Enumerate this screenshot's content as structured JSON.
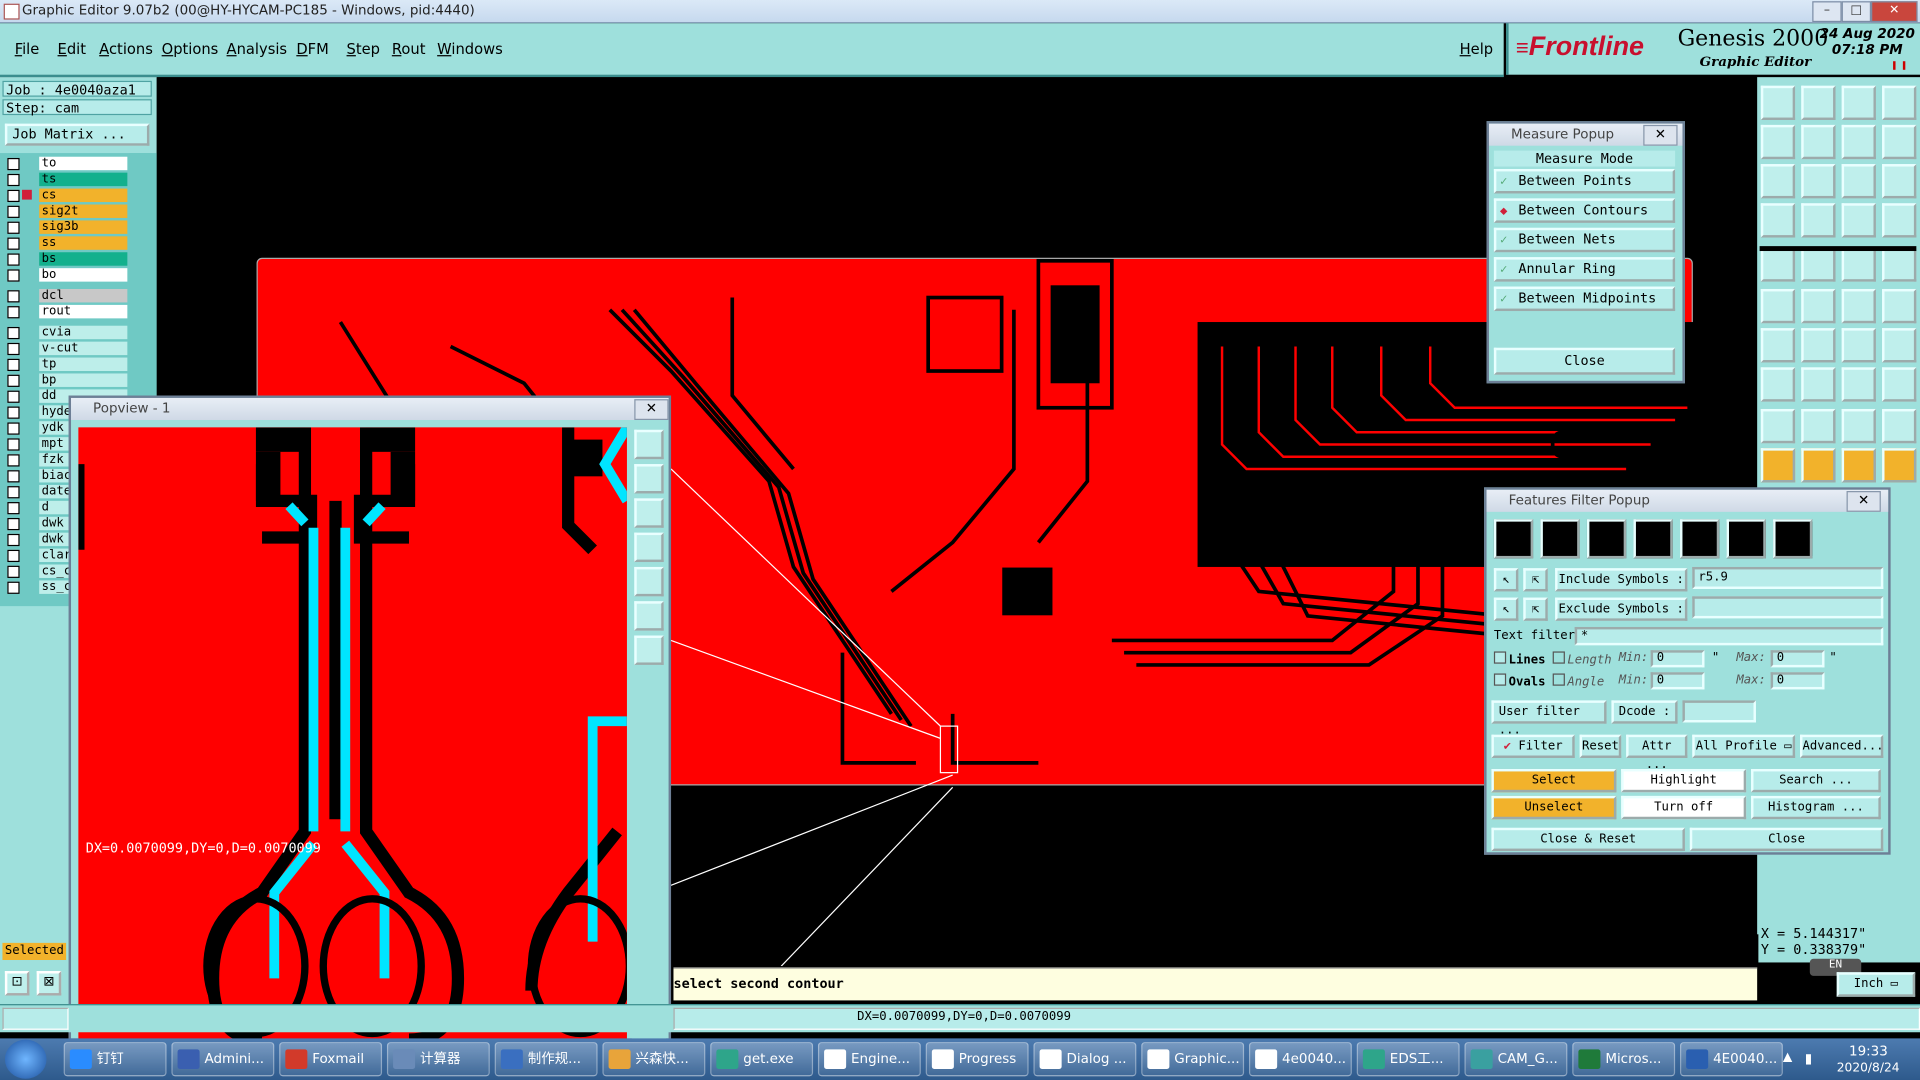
{
  "window": {
    "title": "Graphic Editor 9.07b2 (00@HY-HYCAM-PC185 - Windows, pid:4440)"
  },
  "menu": {
    "items": [
      "File",
      "Edit",
      "Actions",
      "Options",
      "Analysis",
      "DFM",
      "Step",
      "Rout",
      "Windows"
    ],
    "help": "Help"
  },
  "brand": {
    "logo": "Frontline",
    "product": "Genesis 2000",
    "subtitle": "Graphic Editor",
    "date": "24 Aug 2020",
    "time": "07:18 PM"
  },
  "job": {
    "job_line": "Job : 4e0040aza1",
    "step_line": "Step: cam",
    "matrix_button": "Job Matrix ..."
  },
  "layers": [
    {
      "name": "to",
      "color": "#ffffff"
    },
    {
      "name": "ts",
      "color": "#13b08d"
    },
    {
      "name": "cs",
      "color": "#f2b22b"
    },
    {
      "name": "sig2t",
      "color": "#f2b22b"
    },
    {
      "name": "sig3b",
      "color": "#f2b22b"
    },
    {
      "name": "ss",
      "color": "#f2b22b"
    },
    {
      "name": "bs",
      "color": "#13b08d"
    },
    {
      "name": "bo",
      "color": "#ffffff"
    },
    {
      "name": "dcl",
      "color": "#c8c8c8"
    },
    {
      "name": "rout",
      "color": "#ffffff"
    },
    {
      "name": "cvia",
      "color": "#bdeeea"
    },
    {
      "name": "v-cut",
      "color": "#bdeeea"
    },
    {
      "name": "tp",
      "color": "#bdeeea"
    },
    {
      "name": "bp",
      "color": "#bdeeea"
    },
    {
      "name": "dd",
      "color": "#bdeeea"
    },
    {
      "name": "hyde",
      "color": "#bdeeea"
    },
    {
      "name": "ydk",
      "color": "#bdeeea"
    },
    {
      "name": "mpt",
      "color": "#bdeeea"
    },
    {
      "name": "fzk",
      "color": "#bdeeea"
    },
    {
      "name": "biac",
      "color": "#bdeeea"
    },
    {
      "name": "date",
      "color": "#bdeeea"
    },
    {
      "name": "d",
      "color": "#bdeeea"
    },
    {
      "name": "dwk",
      "color": "#bdeeea"
    },
    {
      "name": "dwk",
      "color": "#bdeeea"
    },
    {
      "name": "clar",
      "color": "#bdeeea"
    },
    {
      "name": "cs_c",
      "color": "#bdeeea"
    },
    {
      "name": "ss_c",
      "color": "#bdeeea"
    }
  ],
  "left_footer": {
    "selected": "Selected"
  },
  "popview": {
    "title": "Popview - 1",
    "measure_text": "DX=0.0070099,DY=0,D=0.0070099"
  },
  "measure_popup": {
    "title": "Measure Popup",
    "heading": "Measure Mode",
    "modes": [
      "Between Points",
      "Between Contours",
      "Between Nets",
      "Annular Ring",
      "Between Midpoints"
    ],
    "close": "Close"
  },
  "filter_popup": {
    "title": "Features Filter Popup",
    "include_label": "Include Symbols :",
    "include_value": "r5.9",
    "exclude_label": "Exclude Symbols :",
    "exclude_value": "",
    "text_filter_label": "Text filter",
    "text_filter_value": "*",
    "lines_label": "Lines",
    "ovals_label": "Ovals",
    "length_label": "Length",
    "angle_label": "Angle",
    "min_label": "Min:",
    "max_label": "Max:",
    "length_min": "0",
    "length_max": "0",
    "angle_min": "0",
    "angle_max": "0",
    "quote": "\"",
    "user_filter": "User filter ...",
    "dcode_label": "Dcode :",
    "dcode_value": "",
    "filter": "Filter",
    "reset": "Reset",
    "attr": "Attr ...",
    "all_profile": "All Profile",
    "advanced": "Advanced...",
    "select": "Select",
    "highlight": "Highlight",
    "search": "Search ...",
    "unselect": "Unselect",
    "turn_off": "Turn off",
    "histogram": "Histogram ...",
    "close_reset": "Close & Reset",
    "close": "Close"
  },
  "coords": {
    "x": "X = 5.144317\"",
    "y": "Y = 0.338379\"",
    "unit": "Inch"
  },
  "status": {
    "prompt": "select second contour",
    "result": "DX=0.0070099,DY=0,D=0.0070099"
  },
  "taskbar": {
    "items": [
      "钉钉",
      "Admini...",
      "Foxmail",
      "计算器",
      "制作规...",
      "兴森快...",
      "get.exe",
      "Engine...",
      "Progress",
      "Dialog ...",
      "Graphic...",
      "4e0040...",
      "EDS工...",
      "CAM_G...",
      "Micros...",
      "4E0040..."
    ],
    "time": "19:33",
    "date": "2020/8/24",
    "lang": "EN"
  },
  "colors": {
    "board": "#ff0000",
    "accent": "#9ee0dc",
    "trace": "#000000",
    "highlight": "#00e5ff"
  }
}
